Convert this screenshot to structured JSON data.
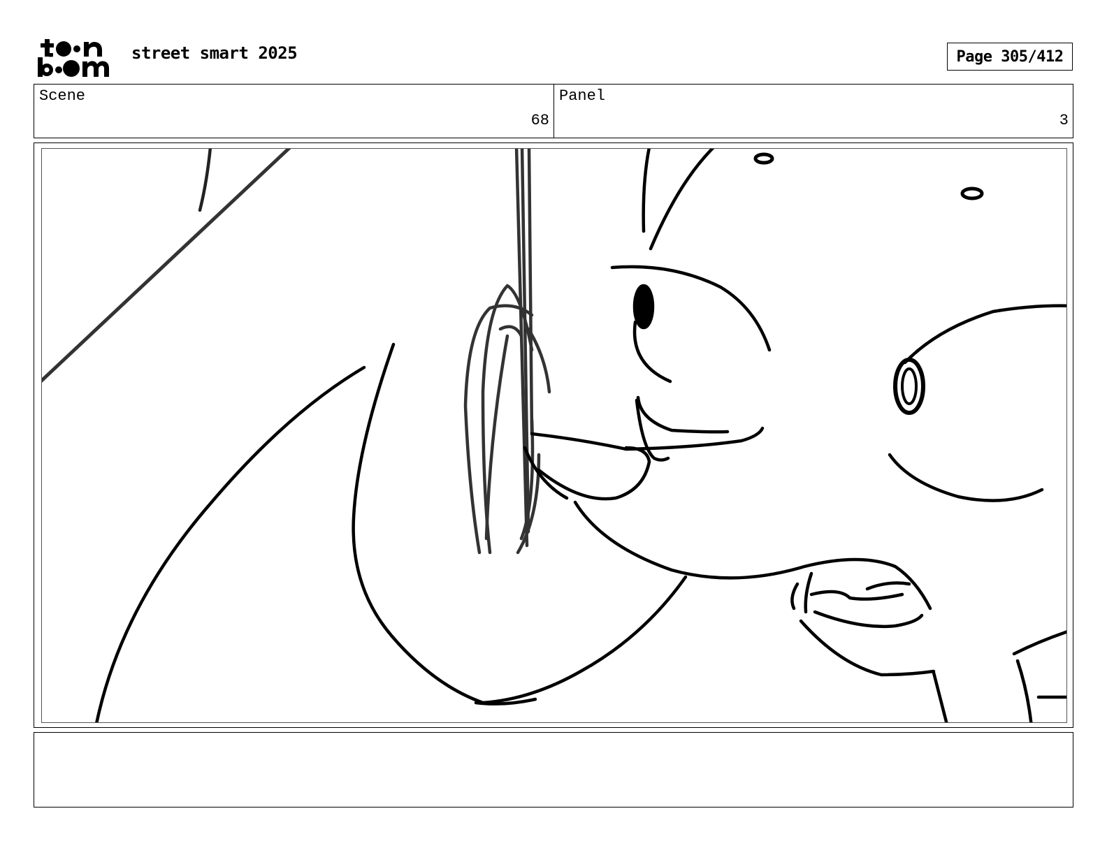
{
  "header": {
    "logo_text": "toon boom",
    "project_title": "street smart 2025",
    "page_label": "Page 305/412"
  },
  "info": {
    "scene_label": "Scene",
    "scene_value": "68",
    "panel_label": "Panel",
    "panel_value": "3"
  },
  "notes": {
    "text": ""
  },
  "colors": {
    "ink": "#000000",
    "frame_border": "#555555",
    "background": "#ffffff"
  }
}
